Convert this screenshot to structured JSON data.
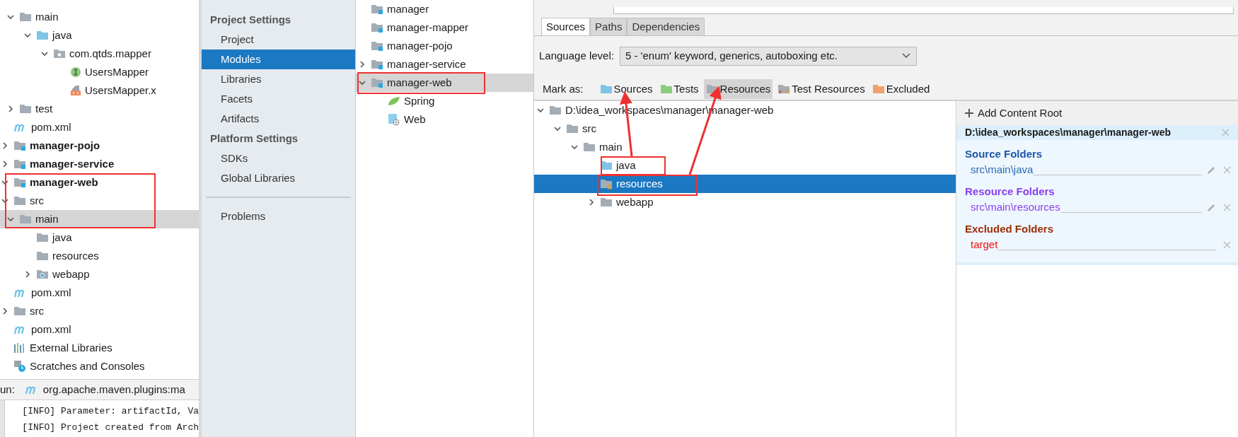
{
  "project_tree": {
    "items": [
      {
        "children": [
          {
            "children": [
              {
                "label": "main",
                "kind": "folder",
                "expanded": true,
                "children": [
                  {
                    "label": "java",
                    "kind": "source-folder",
                    "expanded": true,
                    "children": [
                      {
                        "label": "com.qtds.mapper",
                        "kind": "package",
                        "expanded": true,
                        "children": [
                          {
                            "label": "UsersMapper",
                            "kind": "interface"
                          },
                          {
                            "label": "UsersMapper.x",
                            "kind": "xml"
                          }
                        ]
                      }
                    ]
                  }
                ]
              },
              {
                "label": "test",
                "kind": "folder",
                "expanded": false
              }
            ]
          },
          {
            "label": "pom.xml",
            "kind": "maven"
          }
        ]
      },
      {
        "label": "manager-pojo",
        "kind": "module",
        "bold": true,
        "expanded": false
      },
      {
        "label": "manager-service",
        "kind": "module",
        "bold": true,
        "expanded": false
      },
      {
        "label": "manager-web",
        "kind": "module",
        "bold": true,
        "expanded": true,
        "children": [
          {
            "label": "src",
            "kind": "folder",
            "expanded": true,
            "children": [
              {
                "label": "main",
                "kind": "folder",
                "expanded": true,
                "selected": true,
                "children": [
                  {
                    "label": "java",
                    "kind": "folder"
                  },
                  {
                    "label": "resources",
                    "kind": "folder"
                  },
                  {
                    "label": "webapp",
                    "kind": "web-folder",
                    "expanded": false
                  }
                ]
              }
            ]
          },
          {
            "label": "pom.xml",
            "kind": "maven"
          }
        ]
      },
      {
        "label": "src",
        "kind": "folder",
        "expanded": false
      },
      {
        "label": "pom.xml",
        "kind": "maven"
      },
      {
        "label": "External Libraries",
        "kind": "libraries"
      },
      {
        "label": "Scratches and Consoles",
        "kind": "scratches"
      }
    ]
  },
  "run_bar": {
    "label": "un:",
    "config": "org.apache.maven.plugins:ma"
  },
  "console": [
    "[INFO] Parameter: artifactId, Va",
    "[INFO] Project created from Arch"
  ],
  "settings_sidebar": [
    {
      "kind": "header",
      "label": "Project Settings"
    },
    {
      "kind": "item",
      "label": "Project",
      "selected": false
    },
    {
      "kind": "item",
      "label": "Modules",
      "selected": true
    },
    {
      "kind": "item",
      "label": "Libraries",
      "selected": false
    },
    {
      "kind": "item",
      "label": "Facets",
      "selected": false
    },
    {
      "kind": "item",
      "label": "Artifacts",
      "selected": false
    },
    {
      "kind": "header",
      "label": "Platform Settings"
    },
    {
      "kind": "item",
      "label": "SDKs",
      "selected": false
    },
    {
      "kind": "item",
      "label": "Global Libraries",
      "selected": false
    },
    {
      "kind": "divider"
    },
    {
      "kind": "item",
      "label": "Problems",
      "selected": false
    }
  ],
  "modules": [
    {
      "label": "manager",
      "kind": "module",
      "selected": false
    },
    {
      "label": "manager-mapper",
      "kind": "module",
      "selected": false
    },
    {
      "label": "manager-pojo",
      "kind": "module",
      "selected": false
    },
    {
      "label": "manager-service",
      "kind": "module",
      "expanded": false,
      "selected": false
    },
    {
      "label": "manager-web",
      "kind": "module",
      "expanded": true,
      "selected": true,
      "children": [
        {
          "label": "Spring",
          "kind": "spring",
          "selected": false
        },
        {
          "label": "Web",
          "kind": "web",
          "selected": false
        }
      ]
    }
  ],
  "tabs": [
    {
      "label": "Sources",
      "selected": true
    },
    {
      "label": "Paths",
      "selected": false
    },
    {
      "label": "Dependencies",
      "selected": false
    }
  ],
  "language_level": {
    "label": "Language level:",
    "value": "5 - 'enum' keyword, generics, autoboxing etc."
  },
  "mark_as": {
    "label": "Mark as:",
    "buttons": [
      {
        "label": "Sources",
        "kind": "sources",
        "selected": false
      },
      {
        "label": "Tests",
        "kind": "tests",
        "selected": false
      },
      {
        "label": "Resources",
        "kind": "resources",
        "selected": true
      },
      {
        "label": "Test Resources",
        "kind": "test-resources",
        "selected": false
      },
      {
        "label": "Excluded",
        "kind": "excluded",
        "selected": false
      }
    ]
  },
  "content_tree": [
    {
      "label": "D:\\idea_workspaces\\manager\\manager-web",
      "kind": "folder",
      "expanded": true,
      "children": [
        {
          "label": "src",
          "kind": "folder",
          "expanded": true,
          "children": [
            {
              "label": "main",
              "kind": "folder",
              "expanded": true,
              "children": [
                {
                  "label": "java",
                  "kind": "source-folder",
                  "selected": false
                },
                {
                  "label": "resources",
                  "kind": "resources-folder",
                  "selected": true
                },
                {
                  "label": "webapp",
                  "kind": "folder",
                  "expanded": false,
                  "selected": false
                }
              ]
            }
          ]
        }
      ]
    }
  ],
  "content_roots": {
    "add_label": "Add Content Root",
    "root": "D:\\idea_workspaces\\manager\\manager-web",
    "groups": [
      {
        "title": "Source Folders",
        "color": "#1c55a8",
        "paths": [
          {
            "path": "src\\main\\java",
            "color": "#2a6ab8",
            "editable": true
          }
        ]
      },
      {
        "title": "Resource Folders",
        "color": "#8a3ff0",
        "paths": [
          {
            "path": "src\\main\\resources",
            "color": "#8a3ff0",
            "editable": true
          }
        ]
      },
      {
        "title": "Excluded Folders",
        "color": "#9c2d08",
        "paths": [
          {
            "path": "target",
            "color": "#ee1111",
            "editable": false
          }
        ]
      }
    ]
  }
}
